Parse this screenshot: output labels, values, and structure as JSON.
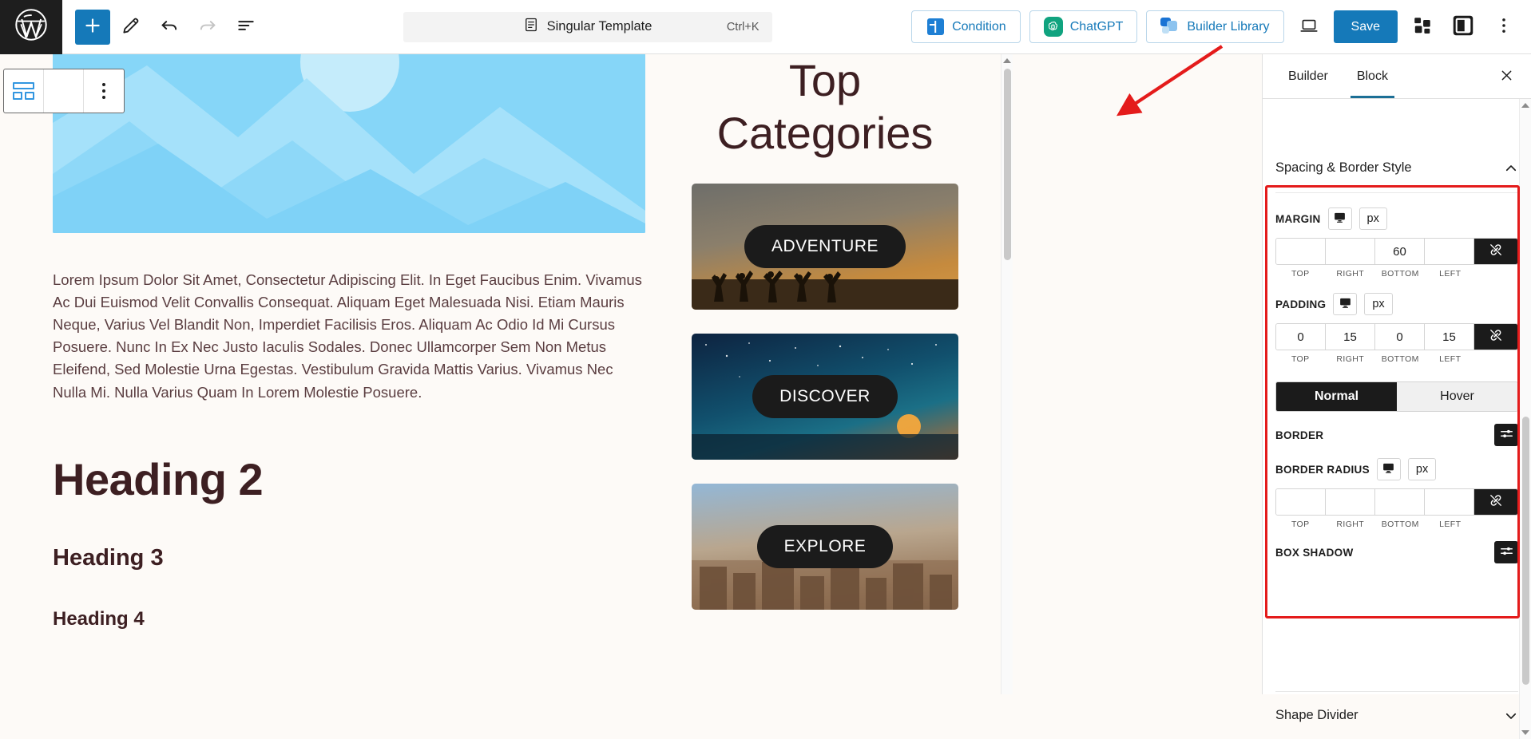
{
  "app": {
    "logo_icon": "wordpress-logo-icon"
  },
  "toolbar": {
    "add_block_label": "+",
    "tools": [
      {
        "name": "add-block-button",
        "icon": "plus-icon"
      },
      {
        "name": "edit-tool-button",
        "icon": "pencil-icon"
      },
      {
        "name": "undo-button",
        "icon": "undo-arrow-icon"
      },
      {
        "name": "redo-button",
        "icon": "redo-arrow-icon"
      },
      {
        "name": "document-overview-button",
        "icon": "list-view-icon"
      }
    ],
    "document_title": "Singular Template",
    "document_title_icon": "document-icon",
    "command_shortcut": "Ctrl+K",
    "condition_label": "Condition",
    "chatgpt_label": "ChatGPT",
    "builder_library_label": "Builder Library",
    "preview_icon": "laptop-preview-icon",
    "save_label": "Save",
    "blocks_icon": "blocks-stack-icon",
    "sidebar_toggle_icon": "sidebar-panel-icon",
    "options_icon": "three-dots-vertical-icon"
  },
  "block_toolbar": {
    "items": [
      {
        "name": "block-type-layout-icon",
        "icon": "columns-layout-icon"
      },
      {
        "name": "block-device-icon",
        "icon": "monitor-icon"
      },
      {
        "name": "block-more-options-icon",
        "icon": "three-dots-vertical-icon"
      }
    ]
  },
  "canvas": {
    "hero_alt": "mountain-landscape-illustration",
    "paragraph": "Lorem Ipsum Dolor Sit Amet, Consectetur Adipiscing Elit. In Eget Faucibus Enim. Vivamus Ac Dui Euismod Velit Convallis Consequat. Aliquam Eget Malesuada Nisi. Etiam Mauris Neque, Varius Vel Blandit Non, Imperdiet Facilisis Eros. Aliquam Ac Odio Id Mi Cursus Posuere. Nunc In Ex Nec Justo Iaculis Sodales. Donec Ullamcorper Sem Non Metus Eleifend, Sed Molestie Urna Egestas. Vestibulum Gravida Mattis Varius. Vivamus Nec Nulla Mi. Nulla Varius Quam In Lorem Molestie Posuere.",
    "heading2": "Heading 2",
    "heading3": "Heading 3",
    "heading4": "Heading 4",
    "categories_title": "Top Categories",
    "categories": [
      {
        "label": "ADVENTURE",
        "image": "people-jumping-sunset-photo"
      },
      {
        "label": "DISCOVER",
        "image": "starry-night-sea-sunset-photo"
      },
      {
        "label": "EXPLORE",
        "image": "city-rooftops-photo"
      }
    ]
  },
  "sidebar": {
    "tabs": [
      {
        "label": "Builder",
        "active": false
      },
      {
        "label": "Block",
        "active": true
      }
    ],
    "close_icon": "close-x-icon",
    "panel": {
      "title": "Spacing & Border Style",
      "collapse_icon": "chevron-up-icon",
      "margin": {
        "label": "MARGIN",
        "device_icon": "desktop-icon",
        "unit": "px",
        "values": {
          "top": "",
          "right": "",
          "bottom": "60",
          "left": ""
        },
        "field_labels": {
          "top": "TOP",
          "right": "RIGHT",
          "bottom": "BOTTOM",
          "left": "LEFT"
        },
        "link_icon": "unlink-icon"
      },
      "padding": {
        "label": "PADDING",
        "device_icon": "desktop-icon",
        "unit": "px",
        "values": {
          "top": "0",
          "right": "15",
          "bottom": "0",
          "left": "15"
        },
        "field_labels": {
          "top": "TOP",
          "right": "RIGHT",
          "bottom": "BOTTOM",
          "left": "LEFT"
        },
        "link_icon": "unlink-icon"
      },
      "state_tabs": [
        {
          "label": "Normal",
          "active": true
        },
        {
          "label": "Hover",
          "active": false
        }
      ],
      "border": {
        "label": "BORDER",
        "settings_icon": "sliders-icon"
      },
      "border_radius": {
        "label": "BORDER RADIUS",
        "device_icon": "desktop-icon",
        "unit": "px",
        "values": {
          "top": "",
          "right": "",
          "bottom": "",
          "left": ""
        },
        "field_labels": {
          "top": "TOP",
          "right": "RIGHT",
          "bottom": "BOTTOM",
          "left": "LEFT"
        },
        "link_icon": "unlink-icon"
      },
      "box_shadow": {
        "label": "BOX SHADOW",
        "settings_icon": "sliders-icon"
      }
    },
    "shape_divider": {
      "title": "Shape Divider",
      "expand_icon": "chevron-down-icon"
    }
  },
  "colors": {
    "accent_blue": "#1579b9",
    "tab_underline": "#1c6f96",
    "annotation_red": "#e41b1b",
    "dark": "#1b1b1b",
    "heading": "#3d1f22",
    "canvas_bg": "#fdfaf7"
  },
  "annotation": {
    "highlight_box": "spacing-border-style-highlight",
    "arrow": "red-pointer-arrow"
  }
}
